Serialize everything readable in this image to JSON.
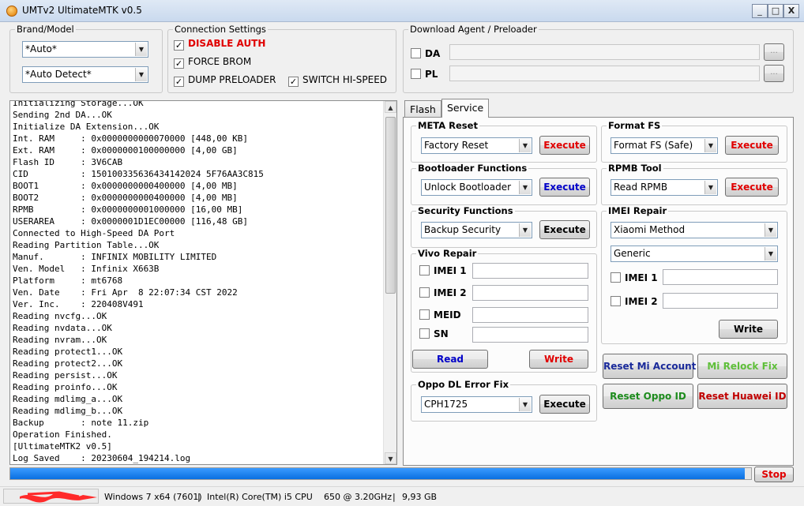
{
  "window": {
    "title": "UMTv2 UltimateMTK v0.5",
    "minimize_label": "_",
    "maximize_label": "□",
    "close_label": "X"
  },
  "brand_model": {
    "legend": "Brand/Model",
    "brand_value": "*Auto*",
    "model_value": "*Auto Detect*"
  },
  "connection": {
    "legend": "Connection Settings",
    "disable_auth": "DISABLE AUTH",
    "force_brom": "FORCE BROM",
    "dump_preloader": "DUMP PRELOADER",
    "switch_hispeed": "SWITCH HI-SPEED",
    "check_mark": "✓",
    "disable_auth_color": "#e00000"
  },
  "download_agent": {
    "legend": "Download Agent / Preloader",
    "da_label": "DA",
    "pl_label": "PL",
    "browse_label": "..."
  },
  "log": {
    "lines": [
      "Initializing Storage...OK",
      "Sending 2nd DA...OK",
      "Initialize DA Extension...OK",
      "Int. RAM     : 0x0000000000070000 [448,00 KB]",
      "Ext. RAM     : 0x0000000100000000 [4,00 GB]",
      "Flash ID     : 3V6CAB",
      "CID          : 150100335636434142024 5F76AA3C815",
      "BOOT1        : 0x0000000000400000 [4,00 MB]",
      "BOOT2        : 0x0000000000400000 [4,00 MB]",
      "RPMB         : 0x0000000001000000 [16,00 MB]",
      "USERAREA     : 0x0000001D1EC00000 [116,48 GB]",
      "Connected to High-Speed DA Port",
      "Reading Partition Table...OK",
      "Manuf.       : INFINIX MOBILITY LIMITED",
      "Ven. Model   : Infinix X663B",
      "Platform     : mt6768",
      "Ven. Date    : Fri Apr  8 22:07:34 CST 2022",
      "Ver. Inc.    : 220408V491",
      "Reading nvcfg...OK",
      "Reading nvdata...OK",
      "Reading nvram...OK",
      "Reading protect1...OK",
      "Reading protect2...OK",
      "Reading persist...OK",
      "Reading proinfo...OK",
      "Reading mdlimg_a...OK",
      "Reading mdlimg_b...OK",
      "Backup       : note 11.zip",
      "Operation Finished.",
      "[UltimateMTK2 v0.5]",
      "Log Saved    : 20230604_194214.log"
    ]
  },
  "tabs": {
    "flash": "Flash",
    "service": "Service"
  },
  "meta_reset": {
    "legend": "META Reset",
    "value": "Factory Reset",
    "execute": "Execute"
  },
  "format_fs": {
    "legend": "Format FS",
    "value": "Format FS (Safe)",
    "execute": "Execute"
  },
  "bootloader": {
    "legend": "Bootloader Functions",
    "value": "Unlock Bootloader",
    "execute": "Execute"
  },
  "rpmb": {
    "legend": "RPMB Tool",
    "value": "Read RPMB",
    "execute": "Execute"
  },
  "security": {
    "legend": "Security Functions",
    "value": "Backup Security",
    "execute": "Execute"
  },
  "imei_repair": {
    "legend": "IMEI Repair",
    "method": "Xiaomi Method",
    "type": "Generic",
    "imei1": "IMEI 1",
    "imei2": "IMEI 2",
    "write": "Write"
  },
  "vivo": {
    "legend": "Vivo Repair",
    "imei1": "IMEI 1",
    "imei2": "IMEI 2",
    "meid": "MEID",
    "sn": "SN",
    "read": "Read",
    "write": "Write"
  },
  "oppo": {
    "legend": "Oppo DL Error Fix",
    "value": "CPH1725",
    "execute": "Execute"
  },
  "actions": {
    "reset_mi": "Reset Mi Account",
    "mi_relock": "Mi Relock Fix",
    "reset_oppo": "Reset Oppo ID",
    "reset_huawei": "Reset Huawei ID"
  },
  "colors": {
    "red": "#e00000",
    "blue": "#0000c8",
    "navy": "#1a2a9a",
    "green": "#1e8c1e",
    "light_green": "#5fbf3a",
    "dark_red": "#c00000"
  },
  "progress": {
    "percent": 99.1,
    "stop": "Stop"
  },
  "statusbar": {
    "os": "Windows 7 x64 (7601)",
    "sep": "|",
    "cpu": "Intel(R) Core(TM) i5 CPU",
    "freq": "650  @ 3.20GHz",
    "ram": "9,93 GB"
  }
}
